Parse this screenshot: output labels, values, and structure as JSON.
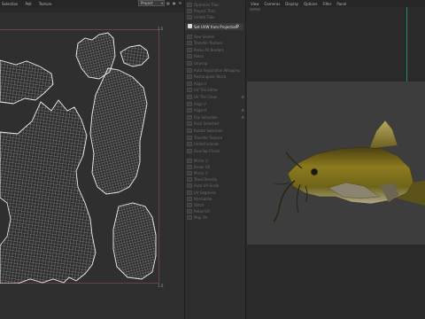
{
  "uv_editor": {
    "menu": [
      "Selection",
      "Pelt",
      "Texture"
    ],
    "dropdown_value": "Project",
    "corner_top_right": "1.0",
    "corner_bottom_right": "1.0"
  },
  "command_panel": {
    "highlighted": "Set UVW from Projection",
    "items_top": [
      "Optimize Tiles",
      "Project Tiles",
      "Unfold Tiles"
    ],
    "items_mid": [
      "Sew Seams",
      "Transfer Texture",
      "Relax All Borders",
      "Relax",
      "Unwrap",
      "Auto Separation Wrapping",
      "Rectangular Block",
      "Align U",
      "UV Tile Editor",
      "UV Tile Clean",
      "Align V",
      "Align H",
      "Flip Selection",
      "Pack Selected",
      "Rotate Selection",
      "Transfer Texture",
      "Unfold Islands",
      "Overlap Check"
    ],
    "items_bottom": [
      "Mirror U",
      "Break UV",
      "Mirror V",
      "Texel Density",
      "Auto UV Scale",
      "UV Segment",
      "Normalize",
      "Stitch",
      "Relax UV",
      "Map UV"
    ]
  },
  "viewport": {
    "menu": [
      "View",
      "Cameras",
      "Display",
      "Options",
      "Filter",
      "Panel"
    ]
  },
  "colors": {
    "uv_wire": "#d8d8d8",
    "uv_border": "#6e4040",
    "viewport_band": "#3d3d3d",
    "fish_body": "#8c7a1e",
    "fish_dark": "#3a3210",
    "fish_belly": "#c8c2b0"
  }
}
